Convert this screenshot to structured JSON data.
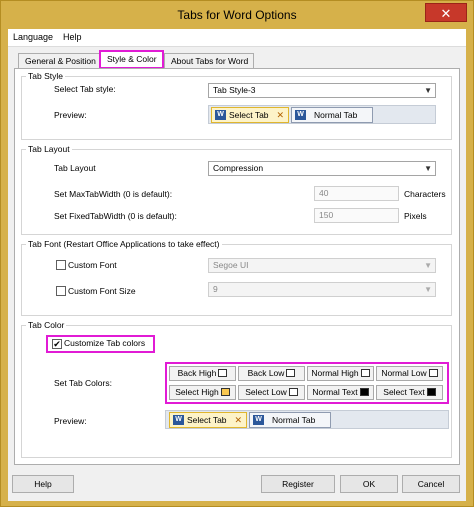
{
  "window": {
    "title": "Tabs for Word Options",
    "close_glyph": "✕"
  },
  "menu": {
    "language": "Language",
    "help": "Help"
  },
  "tabs": [
    {
      "label": "General & Position"
    },
    {
      "label": "Style & Color"
    },
    {
      "label": "About Tabs for Word"
    }
  ],
  "tab_style": {
    "title": "Tab Style",
    "select_label": "Select Tab style:",
    "select_value": "Tab Style-3",
    "preview_label": "Preview:",
    "preview_selected": "Select Tab",
    "preview_normal": "Normal Tab"
  },
  "tab_layout": {
    "title": "Tab Layout",
    "layout_label": "Tab Layout",
    "layout_value": "Compression",
    "max_label": "Set MaxTabWidth (0 is default):",
    "max_value": "40",
    "max_unit": "Characters",
    "fixed_label": "Set FixedTabWidth (0 is default):",
    "fixed_value": "150",
    "fixed_unit": "Pixels"
  },
  "tab_font": {
    "title": "Tab Font (Restart Office Applications to take effect)",
    "font_label": "Custom Font",
    "font_value": "Segoe UI",
    "size_label": "Custom Font Size",
    "size_value": "9"
  },
  "tab_color": {
    "title": "Tab Color",
    "customize_label": "Customize Tab colors",
    "customize_checked": "✔",
    "set_colors_label": "Set Tab Colors:",
    "buttons_row1": [
      {
        "label": "Back High",
        "color": "#ffffff"
      },
      {
        "label": "Back Low",
        "color": "#ffffff"
      },
      {
        "label": "Normal High",
        "color": "#ffffff"
      },
      {
        "label": "Normal Low",
        "color": "#ffffff"
      }
    ],
    "buttons_row2": [
      {
        "label": "Select High",
        "color": "#f9c74f"
      },
      {
        "label": "Select Low",
        "color": "#ffffff"
      },
      {
        "label": "Normal Text",
        "color": "#000000"
      },
      {
        "label": "Select Text",
        "color": "#000000"
      }
    ],
    "preview_label": "Preview:",
    "preview_selected": "Select Tab",
    "preview_normal": "Normal Tab"
  },
  "buttons": {
    "help": "Help",
    "register": "Register",
    "ok": "OK",
    "cancel": "Cancel"
  },
  "icons": {
    "word_glyph": "W",
    "tab_close_glyph": "✕",
    "dropdown_glyph": "▼"
  }
}
